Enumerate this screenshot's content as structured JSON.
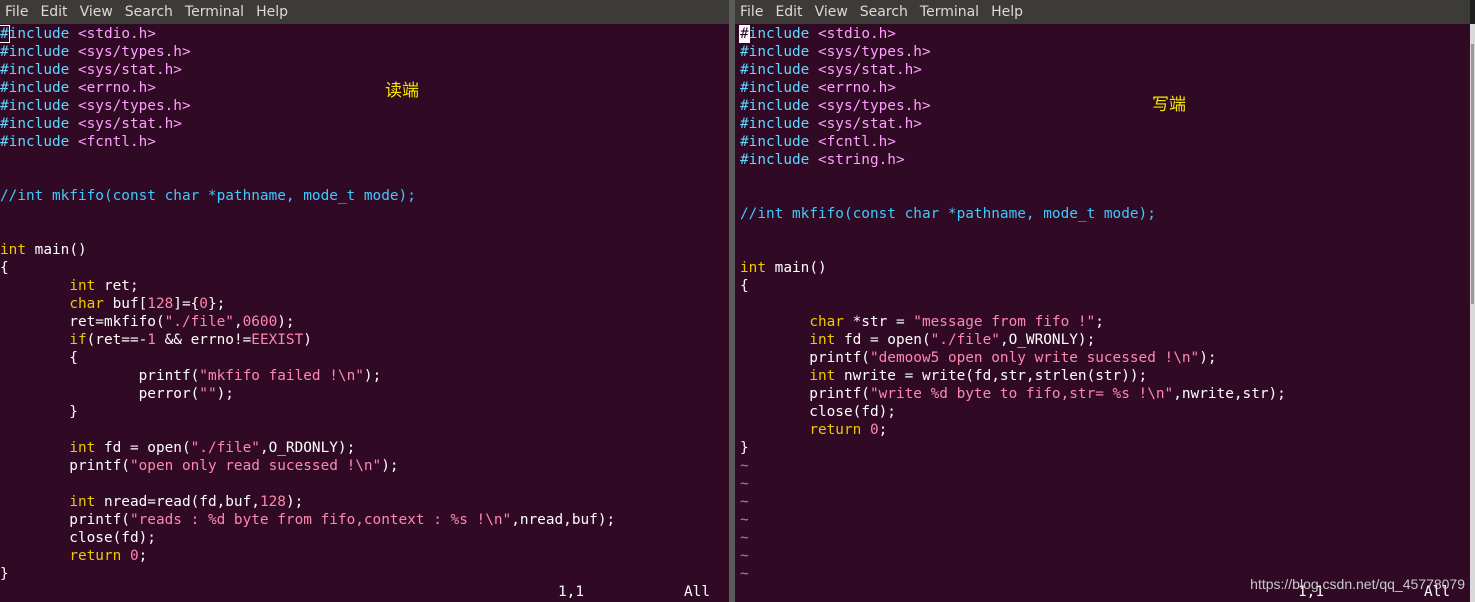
{
  "menu": {
    "file": "File",
    "edit": "Edit",
    "view": "View",
    "search": "Search",
    "terminal": "Terminal",
    "help": "Help"
  },
  "left": {
    "label": "读端",
    "status_pos": "1,1",
    "status_all": "All",
    "code": [
      "#include <stdio.h>",
      "#include <sys/types.h>",
      "#include <sys/stat.h>",
      "#include <errno.h>",
      "#include <sys/types.h>",
      "#include <sys/stat.h>",
      "#include <fcntl.h>",
      "",
      "",
      "//int mkfifo(const char *pathname, mode_t mode);",
      "",
      "",
      "int main()",
      "{",
      "        int ret;",
      "        char buf[128]={0};",
      "        ret=mkfifo(\"./file\",0600);",
      "        if(ret==-1 && errno!=EEXIST)",
      "        {",
      "                printf(\"mkfifo failed !\\n\");",
      "                perror(\"\");",
      "        }",
      "",
      "        int fd = open(\"./file\",O_RDONLY);",
      "        printf(\"open only read sucessed !\\n\");",
      "",
      "        int nread=read(fd,buf,128);",
      "        printf(\"reads : %d byte from fifo,context : %s !\\n\",nread,buf);",
      "        close(fd);",
      "        return 0;",
      "}"
    ]
  },
  "right": {
    "label": "写端",
    "status_pos": "1,1",
    "status_all": "All",
    "code": [
      "#include <stdio.h>",
      "#include <sys/types.h>",
      "#include <sys/stat.h>",
      "#include <errno.h>",
      "#include <sys/types.h>",
      "#include <sys/stat.h>",
      "#include <fcntl.h>",
      "#include <string.h>",
      "",
      "",
      "//int mkfifo(const char *pathname, mode_t mode);",
      "",
      "",
      "int main()",
      "{",
      "",
      "        char *str = \"message from fifo !\";",
      "        int fd = open(\"./file\",O_WRONLY);",
      "        printf(\"demoow5 open only write sucessed !\\n\");",
      "        int nwrite = write(fd,str,strlen(str));",
      "        printf(\"write %d byte to fifo,str= %s !\\n\",nwrite,str);",
      "        close(fd);",
      "        return 0;",
      "}",
      "~",
      "~",
      "~",
      "~",
      "~",
      "~",
      "~"
    ]
  },
  "watermark": "https://blog.csdn.net/qq_45778079",
  "colors": {
    "background": "#300a24",
    "menubar": "#3c3b37",
    "keyword": "#eec900",
    "preproc": "#5fd7ff",
    "string": "#ff87af",
    "label": "#f5e600"
  }
}
